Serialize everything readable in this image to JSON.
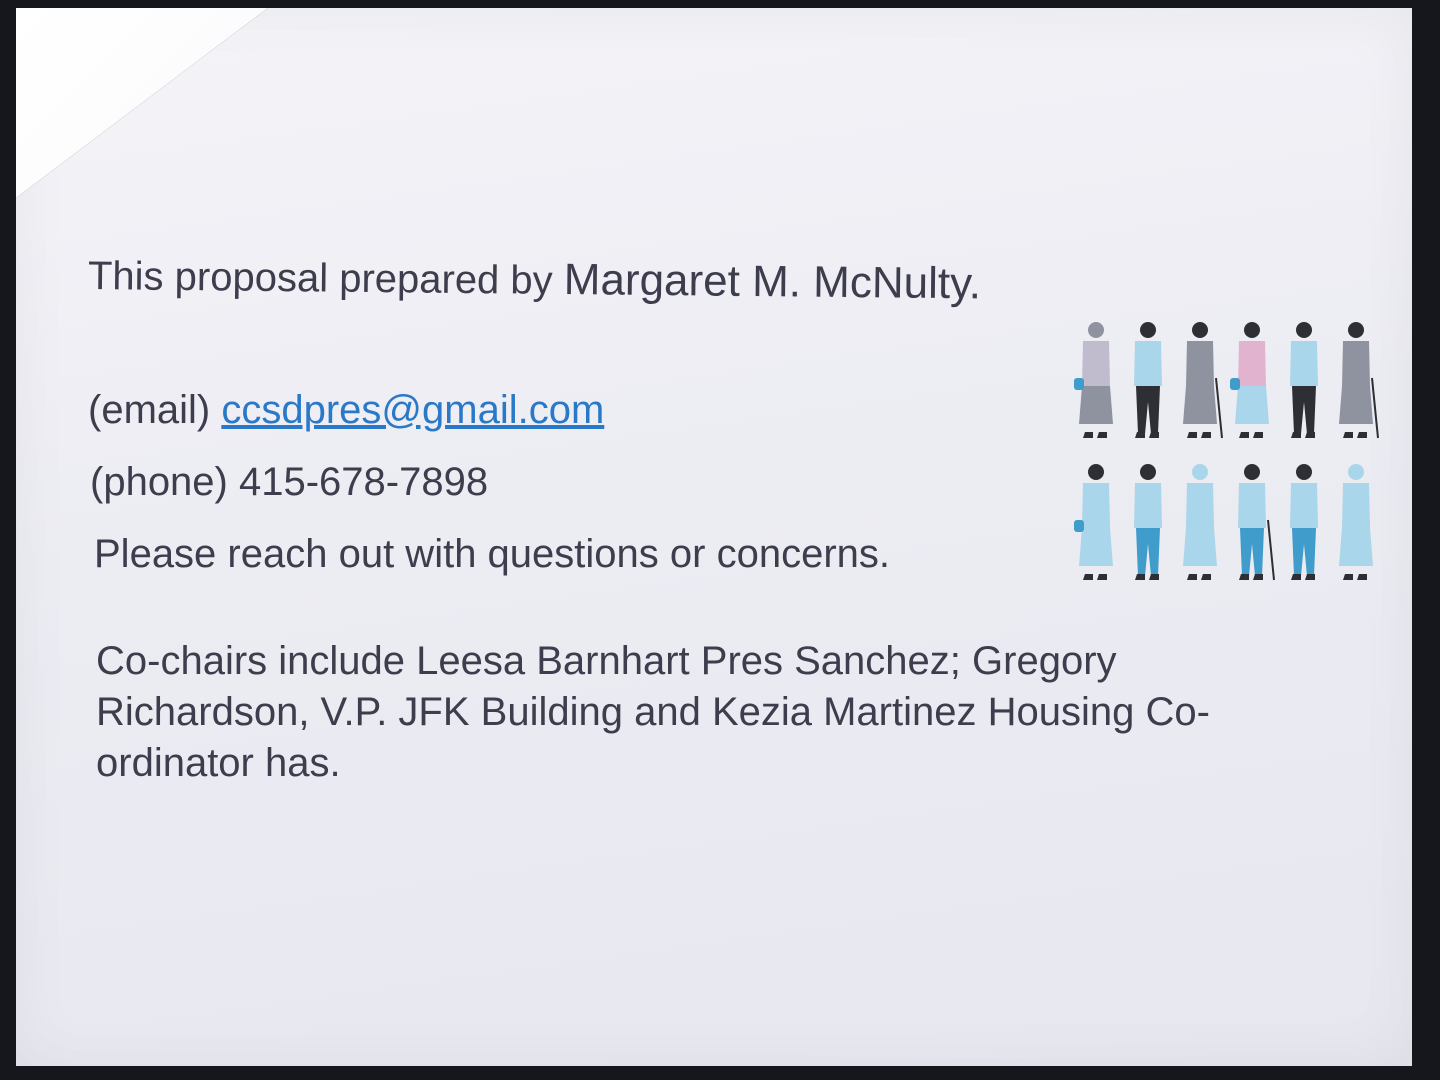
{
  "document": {
    "prepared_by_prefix": "This proposal prepared by",
    "prepared_by_name": "Margaret M. McNulty.",
    "email_label": "(email)",
    "email_address": "ccsdpres@gmail.com",
    "phone_label": "(phone)",
    "phone_number": "415-678-7898",
    "note": "Please reach out with questions or concerns.",
    "cochairs": "Co-chairs include Leesa Barnhart Pres Sanchez; Gregory Richardson, V.P. JFK Building and Kezia Martinez Housing Co-ordinator has."
  },
  "illustration": {
    "icon": "seniors-group-icon",
    "colors": {
      "dark": "#2e2f35",
      "light_blue": "#a9d6ea",
      "mid_blue": "#3f9ccb",
      "gray": "#8f93a0",
      "pink": "#e2b3cf",
      "lavender": "#c0bccd"
    }
  }
}
